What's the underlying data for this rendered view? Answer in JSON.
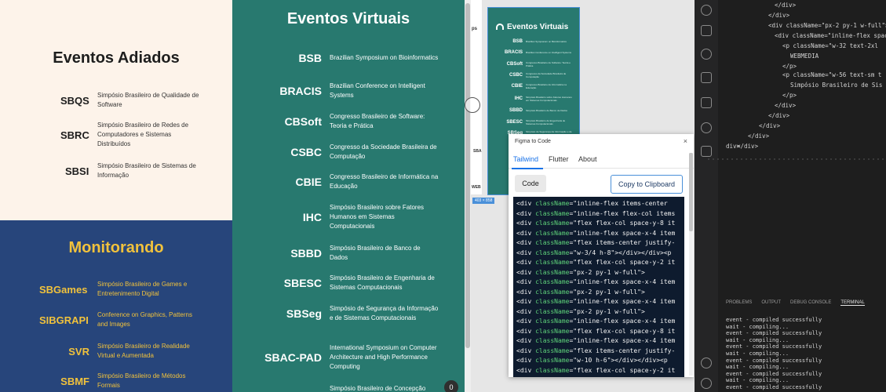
{
  "adiados": {
    "title": "Eventos Adiados",
    "events": [
      {
        "abbr": "SBQS",
        "desc": "Simpósio Brasileiro de Qualidade de Software"
      },
      {
        "abbr": "SBRC",
        "desc": "Simpósio Brasileiro de Redes de Computadores e Sistemas Distribuídos"
      },
      {
        "abbr": "SBSI",
        "desc": "Simpósio Brasileiro de Sistemas de Informação"
      }
    ]
  },
  "monitorando": {
    "title": "Monitorando",
    "events": [
      {
        "abbr": "SBGames",
        "desc": "Simpósio Brasileiro de Games e Entretenimento Digital"
      },
      {
        "abbr": "SIBGRAPI",
        "desc": "Conference on Graphics, Patterns and Images"
      },
      {
        "abbr": "SVR",
        "desc": "Simpósio Brasileiro de Realidade Virtual e Aumentada"
      },
      {
        "abbr": "SBMF",
        "desc": "Simpósio Brasileiro de Métodos Formais"
      }
    ]
  },
  "virtuais": {
    "title": "Eventos Virtuais",
    "events": [
      {
        "abbr": "BSB",
        "desc": "Brazilian Symposium on Bioinformatics"
      },
      {
        "abbr": "BRACIS",
        "desc": "Brazilian Conference on Intelligent Systems"
      },
      {
        "abbr": "CBSoft",
        "desc": "Congresso Brasileiro de Software: Teoria e Prática"
      },
      {
        "abbr": "CSBC",
        "desc": "Congresso da Sociedade Brasileira de Computação"
      },
      {
        "abbr": "CBIE",
        "desc": "Congresso Brasileiro de Informática na Educação"
      },
      {
        "abbr": "IHC",
        "desc": "Simpósio Brasileiro sobre Fatores Humanos em Sistemas Computacionais"
      },
      {
        "abbr": "SBBD",
        "desc": "Simpósio Brasileiro de Banco de Dados"
      },
      {
        "abbr": "SBESC",
        "desc": "Simpósio Brasileiro de Engenharia de Sistemas Computacionais"
      },
      {
        "abbr": "SBSeg",
        "desc": "Simpósio de Segurança da Informação e de Sistemas Computacionais"
      },
      {
        "abbr": "SBAC-PAD",
        "desc": "International Symposium on Computer Architecture and High Performance Computing"
      },
      {
        "abbr": "",
        "desc": "Simpósio Brasileiro de Concepção"
      }
    ],
    "scroll_badge": "0"
  },
  "figma_canvas": {
    "mini_left_title": "ps",
    "mini_left_sba": "SBA",
    "mini_left_web": "WEB",
    "frame_title": "Eventos Virtuais",
    "frame_abbrs": [
      "BSB",
      "BRACIS",
      "CBSoft",
      "CSBC",
      "CBIE",
      "IHC",
      "SBBD",
      "SBESC",
      "SBSeg"
    ],
    "selection_tag": "403 × 858"
  },
  "plugin": {
    "title": "Figma to Code",
    "close": "×",
    "tabs": [
      "Tailwind",
      "Flutter",
      "About"
    ],
    "active_tab": "Tailwind",
    "code_button": "Code",
    "copy_button": "Copy to Clipboard",
    "code_lines": [
      {
        "tag": "<div ",
        "attr": "className",
        "val": "=\"inline-flex items-center "
      },
      {
        "tag": "<div ",
        "attr": "className",
        "val": "=\"inline-flex flex-col items"
      },
      {
        "tag": "<div ",
        "attr": "className",
        "val": "=\"flex flex-col space-y-8 it"
      },
      {
        "tag": "<div ",
        "attr": "className",
        "val": "=\"inline-flex space-x-4 item"
      },
      {
        "tag": "<div ",
        "attr": "className",
        "val": "=\"flex items-center justify-"
      },
      {
        "tag": "<div ",
        "attr": "className",
        "val": "=\"w-3/4 h-8\"></div></div><p"
      },
      {
        "tag": "<div ",
        "attr": "className",
        "val": "=\"flex flex-col space-y-2 it"
      },
      {
        "tag": "<div ",
        "attr": "className",
        "val": "=\"px-2 py-1 w-full\">"
      },
      {
        "tag": "<div ",
        "attr": "className",
        "val": "=\"inline-flex space-x-4 item"
      },
      {
        "tag": "<div ",
        "attr": "className",
        "val": "=\"px-2 py-1 w-full\">"
      },
      {
        "tag": "<div ",
        "attr": "className",
        "val": "=\"inline-flex space-x-4 item"
      },
      {
        "tag": "<div ",
        "attr": "className",
        "val": "=\"px-2 py-1 w-full\">"
      },
      {
        "tag": "<div ",
        "attr": "className",
        "val": "=\"inline-flex space-x-4 item"
      },
      {
        "tag": "<div ",
        "attr": "className",
        "val": "=\"flex flex-col space-y-8 it"
      },
      {
        "tag": "<div ",
        "attr": "className",
        "val": "=\"inline-flex space-x-4 item"
      },
      {
        "tag": "<div ",
        "attr": "className",
        "val": "=\"flex items-center justify-"
      },
      {
        "tag": "<div ",
        "attr": "className",
        "val": "=\"w-10 h-6\"></div></div><p"
      },
      {
        "tag": "<div ",
        "attr": "className",
        "val": "=\"flex flex-col space-y-2 it"
      }
    ]
  },
  "vscode": {
    "code_lines": [
      "</div>",
      "</div>",
      "<div className=\"px-2 py-1 w-full\">",
      "<div className=\"inline-flex space",
      "<p className=\"w-32 text-2xl",
      "WEBMEDIA",
      "</p>",
      "<p className=\"w-56 text-sm t",
      "Simpósio Brasileiro de Sis",
      "</p>",
      "</div>",
      "</div>",
      "</div>",
      "</div>",
      "</div>",
      "div>"
    ],
    "panel_tabs": [
      "PROBLEMS",
      "OUTPUT",
      "DEBUG CONSOLE",
      "TERMINAL"
    ],
    "active_panel": "TERMINAL",
    "terminal_lines": [
      "event - compiled successfully",
      "wait  - compiling...",
      "event - compiled successfully",
      "wait  - compiling...",
      "event - compiled successfully",
      "wait  - compiling...",
      "event - compiled successfully",
      "wait  - compiling...",
      "event - compiled successfully",
      "wait  - compiling...",
      "event - compiled successfully"
    ]
  }
}
